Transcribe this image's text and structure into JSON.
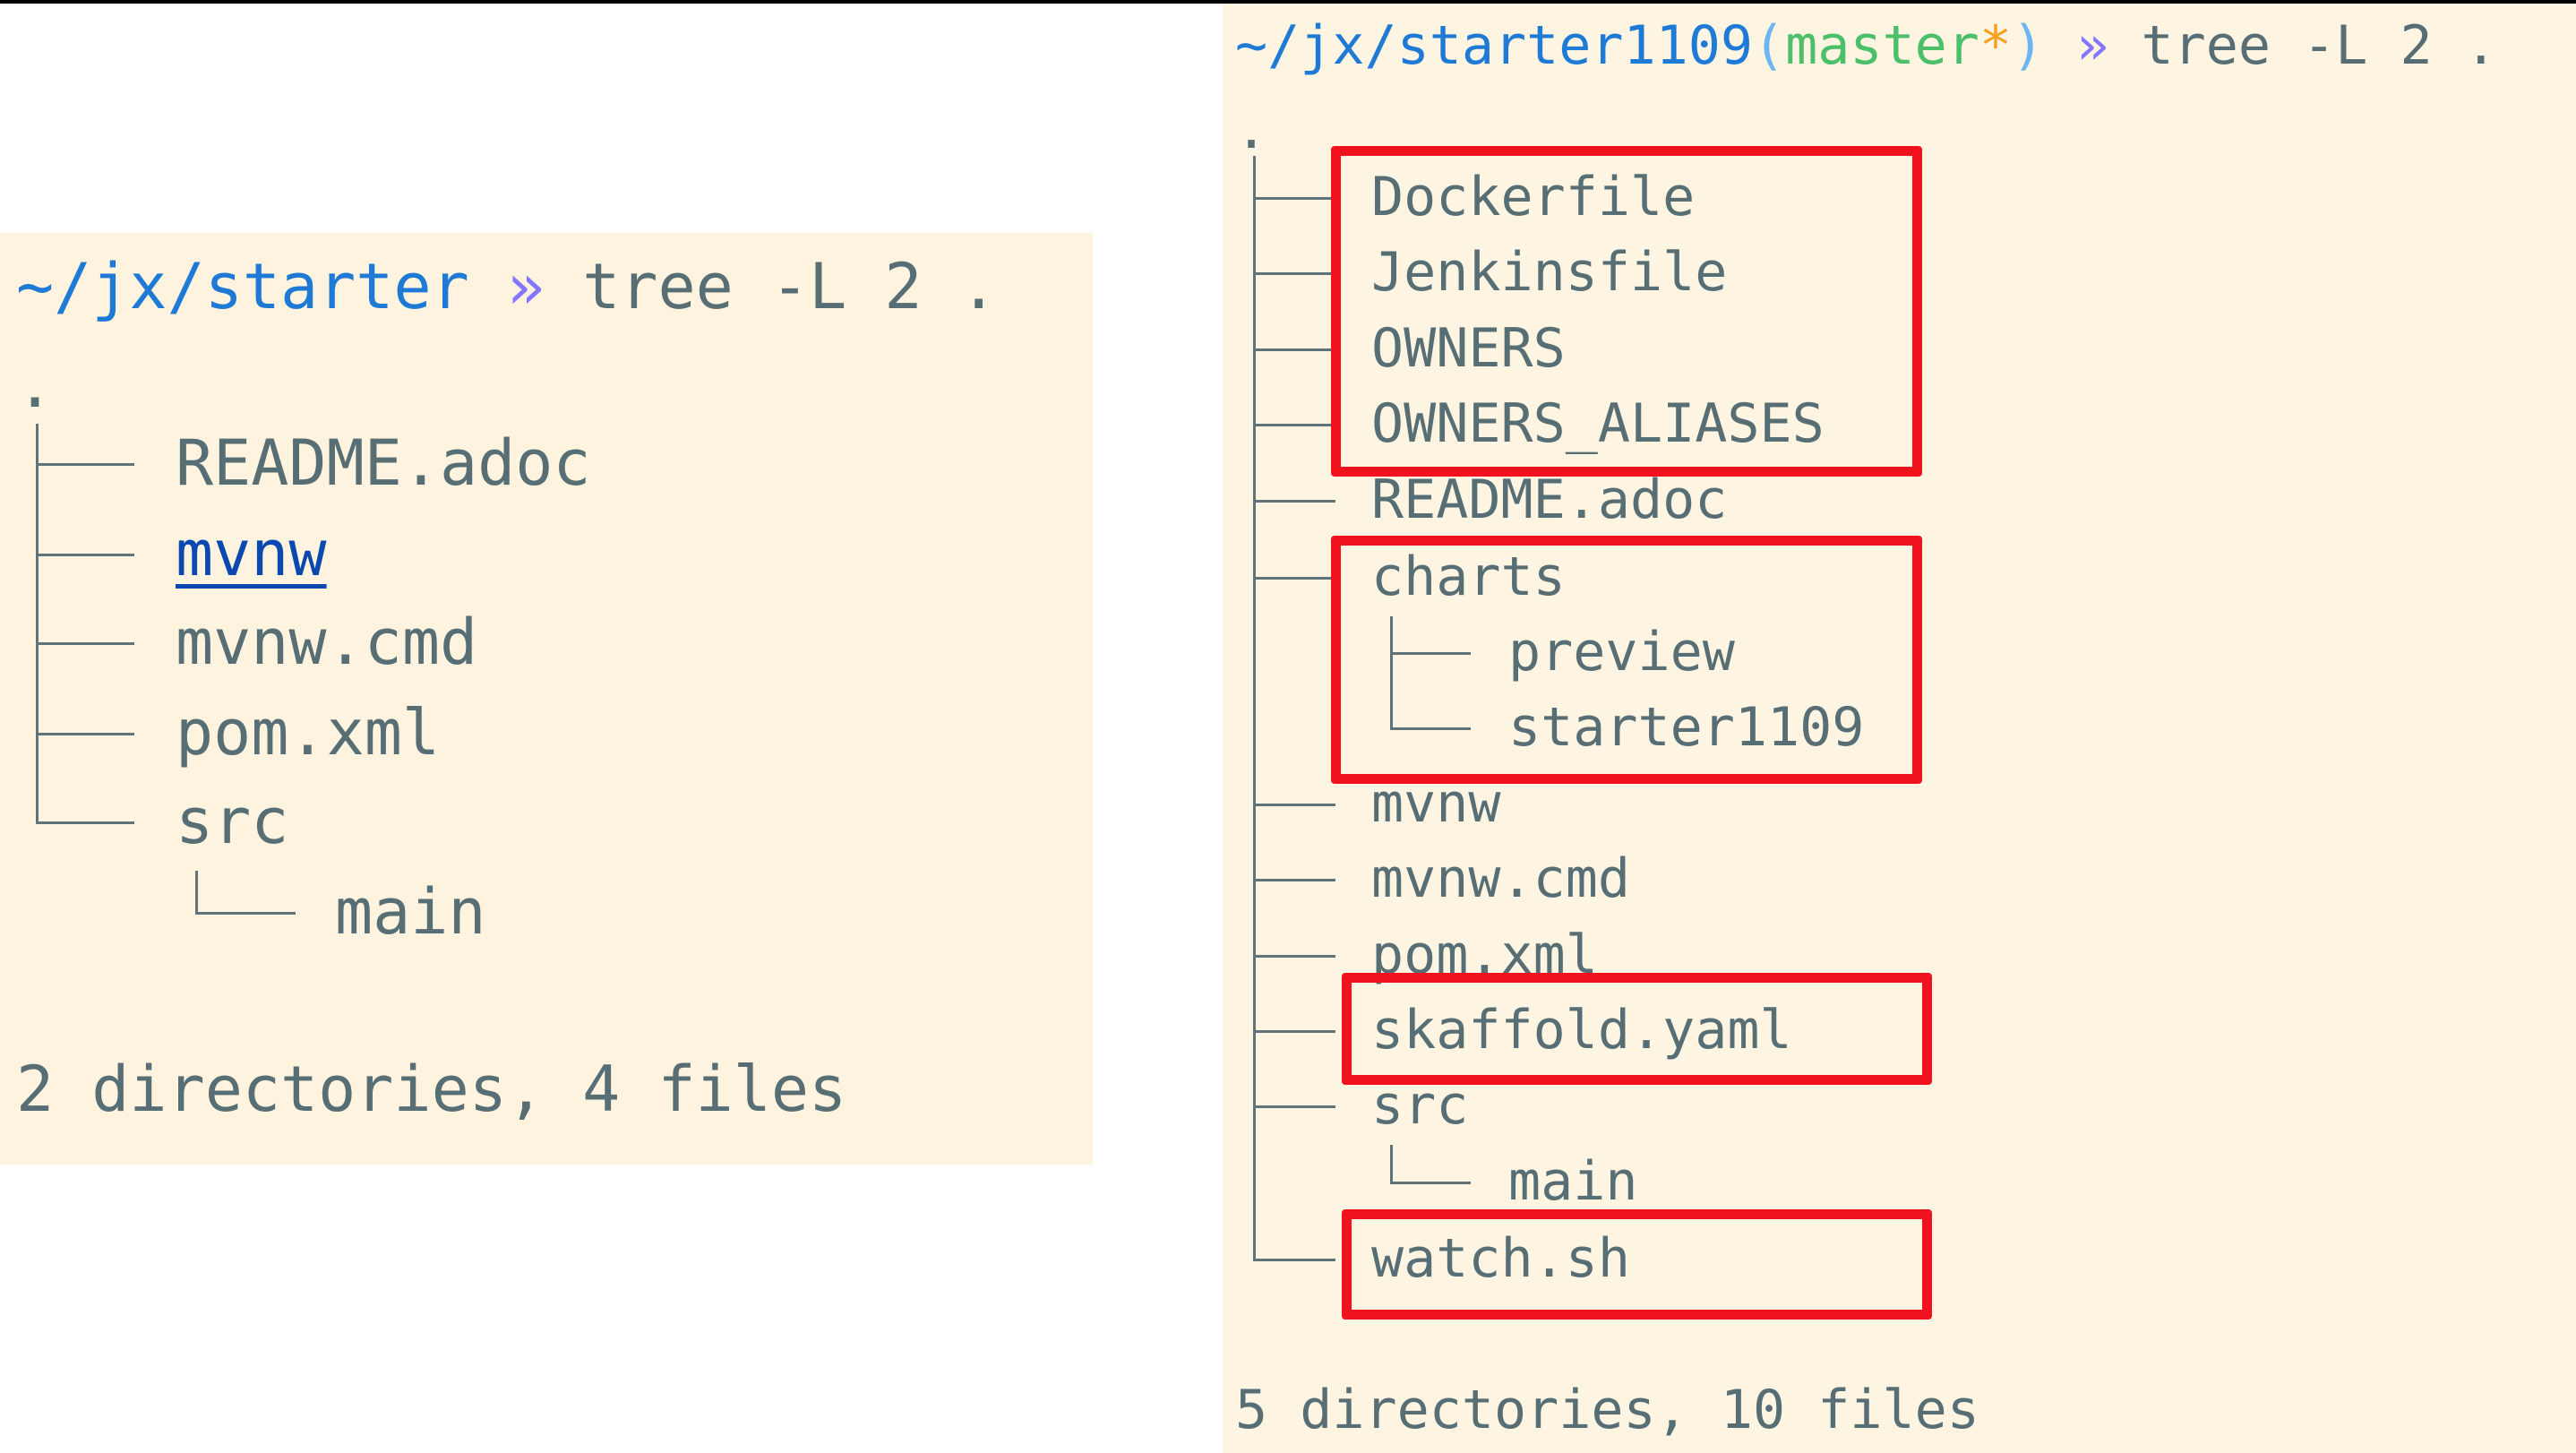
{
  "left_terminal": {
    "prompt": {
      "path": "~/jx/starter",
      "separator": "»",
      "command": "tree -L 2 ."
    },
    "root": ".",
    "entries": [
      "README.adoc",
      "mvnw",
      "mvnw.cmd",
      "pom.xml",
      "src"
    ],
    "src_children": [
      "main"
    ],
    "summary": "2 directories, 4 files"
  },
  "right_terminal": {
    "prompt": {
      "path": "~/jx/starter1109",
      "paren_open": "(",
      "branch": "master",
      "dirty": "*",
      "paren_close": ")",
      "separator": "»",
      "command": "tree -L 2 ."
    },
    "root": ".",
    "entries": [
      "Dockerfile",
      "Jenkinsfile",
      "OWNERS",
      "OWNERS_ALIASES",
      "README.adoc",
      "charts",
      "mvnw",
      "mvnw.cmd",
      "pom.xml",
      "skaffold.yaml",
      "src",
      "watch.sh"
    ],
    "charts_children": [
      "preview",
      "starter1109"
    ],
    "src_children": [
      "main"
    ],
    "summary": "5 directories, 10 files"
  },
  "colors": {
    "highlight_box": "#f0131e",
    "background": "#fdf3df",
    "text": "#586e75",
    "path": "#1f7ad6",
    "branch": "#4cbf6a"
  }
}
